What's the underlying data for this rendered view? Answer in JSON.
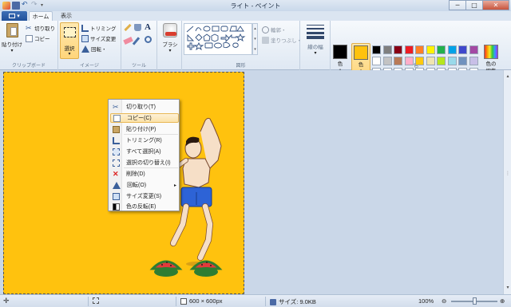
{
  "window": {
    "title": "ライト - ペイント",
    "controls": {
      "minimize": "─",
      "maximize": "□",
      "close": "✕"
    }
  },
  "tabs": {
    "file": "▾",
    "home": "ホーム",
    "view": "表示"
  },
  "ribbon": {
    "clipboard": {
      "paste": "貼り付け",
      "cut": "切り取り",
      "copy": "コピー",
      "group_label": "クリップボード"
    },
    "image": {
      "select": "選択",
      "crop": "トリミング",
      "resize": "サイズ変更",
      "rotate": "回転・",
      "group_label": "イメージ"
    },
    "tools": {
      "group_label": "ツール"
    },
    "brushes": {
      "label": "ブラシ"
    },
    "shapes": {
      "outline": "輪郭・",
      "fill": "塗りつぶし・",
      "group_label": "図形"
    },
    "size": {
      "label": "線の幅"
    },
    "colors": {
      "color1_label": "色\n1",
      "color2_label": "色\n2",
      "color1": "#000000",
      "color2": "#ffc20e",
      "edit_label": "色の\n編集",
      "group_label": "色",
      "palette_row1": [
        "#000000",
        "#7f7f7f",
        "#880015",
        "#ed1c24",
        "#ff7f27",
        "#fff200",
        "#22b14c",
        "#00a2e8",
        "#3f48cc",
        "#a349a4"
      ],
      "palette_row2": [
        "#ffffff",
        "#c3c3c3",
        "#b97a57",
        "#ffaec9",
        "#ffc90e",
        "#efe4b0",
        "#b5e61d",
        "#99d9ea",
        "#7092be",
        "#c8bfe7"
      ],
      "palette_row3": [
        "#ffffff",
        "#ffffff",
        "#ffffff",
        "#ffffff",
        "#ffffff",
        "#ffffff",
        "#ffffff",
        "#ffffff",
        "#ffffff",
        "#ffffff"
      ]
    }
  },
  "context_menu": {
    "items": [
      {
        "label": "切り取り(T)",
        "icon": "scissors-icon"
      },
      {
        "label": "コピー(C)",
        "icon": "copy-icon",
        "highlighted": true
      },
      {
        "label": "貼り付け(P)",
        "icon": "clipboard-icon"
      },
      {
        "label": "トリミング(R)",
        "icon": "crop-icon"
      },
      {
        "label": "すべて選択(A)",
        "icon": "select-all-icon"
      },
      {
        "label": "選択の切り替え(I)",
        "icon": "invert-selection-icon"
      },
      {
        "label": "削除(D)",
        "icon": "delete-icon"
      },
      {
        "label": "回転(O)",
        "icon": "rotate-icon",
        "submenu": "▸"
      },
      {
        "label": "サイズ変更(S)",
        "icon": "resize-icon"
      },
      {
        "label": "色の反転(E)",
        "icon": "invert-color-icon"
      }
    ]
  },
  "statusbar": {
    "dimensions": "600 × 600px",
    "filesize": "サイズ: 9.0KB",
    "zoom": "100%",
    "zoom_out": "⊖",
    "zoom_in": "⊕"
  }
}
